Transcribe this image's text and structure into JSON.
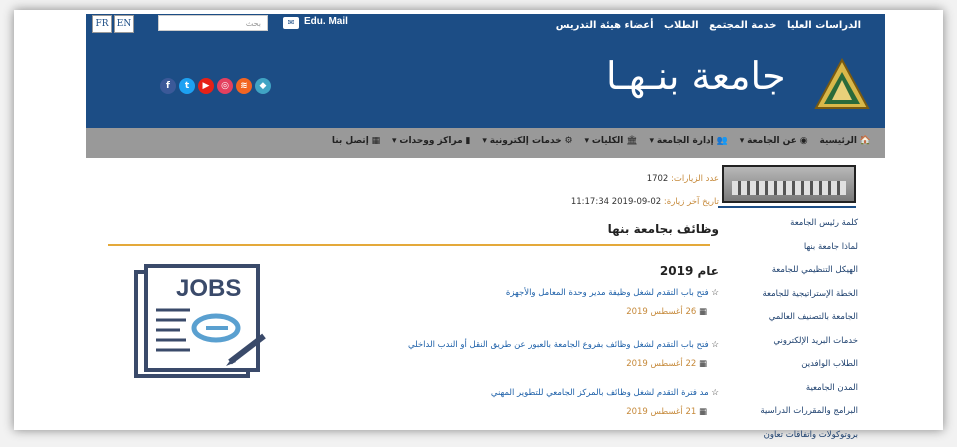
{
  "topbar": {
    "links": [
      "الدراسات العليا",
      "خدمة المجتمع",
      "الطلاب",
      "أعضاء هيئة التدريس"
    ],
    "mail_label": "Edu. Mail",
    "mail_icon": "mail-icon",
    "search_placeholder": "بحث",
    "lang_en": "EN",
    "lang_fr": "FR"
  },
  "header": {
    "university_name": "جامعة بنـهـا",
    "social": [
      {
        "icon": "facebook-icon",
        "color": "#3b5998",
        "glyph": "f"
      },
      {
        "icon": "twitter-icon",
        "color": "#1da1f2",
        "glyph": "t"
      },
      {
        "icon": "youtube-icon",
        "color": "#e62117",
        "glyph": "▶"
      },
      {
        "icon": "instagram-icon",
        "color": "#e4405f",
        "glyph": "◎"
      },
      {
        "icon": "rss-icon",
        "color": "#f26522",
        "glyph": "≋"
      },
      {
        "icon": "periscope-icon",
        "color": "#40a4c4",
        "glyph": "◆"
      }
    ]
  },
  "nav": {
    "items": [
      "الرئيسية",
      "عن الجامعة",
      "إدارة الجامعة",
      "الكليات",
      "خدمات إلكترونية",
      "مراكز ووحدات",
      "إتصل بنا"
    ]
  },
  "sidebar": {
    "items": [
      "كلمة رئيس الجامعة",
      "لماذا جامعة بنها",
      "الهيكل التنظيمي للجامعة",
      "الخطة الإستراتيجية للجامعة",
      "الجامعة بالتصنيف العالمي",
      "خدمات البريد الإلكتروني",
      "الطلاب الوافدين",
      "المدن الجامعية",
      "البرامج والمقررات الدراسية",
      "بروتوكولات واتفاقات تعاون"
    ]
  },
  "main": {
    "visits_label": "عدد الزيارات:",
    "visits_value": "1702",
    "last_visit_label": "تاريخ آخر زيارة:",
    "last_visit_value": "02-09-2019 11:17:34",
    "page_title": "وظائف بجامعة بنها",
    "year_heading": "عام 2019",
    "jobs": [
      {
        "title": "فتح باب التقدم لشغل وظيفة مدير وحدة المعامل والأجهزة",
        "date": "26 أغسطس 2019"
      },
      {
        "title": "فتح باب التقدم لشغل وظائف بفروع الجامعة بالعبور عن طريق النقل أو الندب الداخلي",
        "date": "22 أغسطس 2019"
      },
      {
        "title": "مد فترة التقدم لشغل وظائف بالمركز الجامعي للتطوير المهني",
        "date": "21 أغسطس 2019"
      }
    ],
    "jobs_image_text": "JOBS"
  }
}
